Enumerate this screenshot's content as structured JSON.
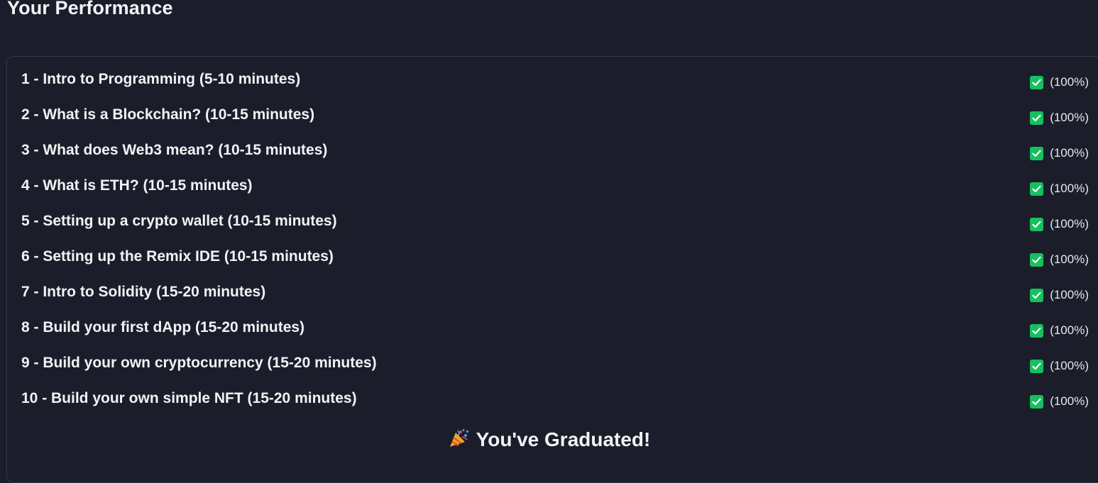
{
  "page": {
    "title": "Your Performance"
  },
  "lessons": [
    {
      "title": "1 - Intro to Programming (5-10 minutes)",
      "percent": "(100%)",
      "completed": true
    },
    {
      "title": "2 - What is a Blockchain? (10-15 minutes)",
      "percent": "(100%)",
      "completed": true
    },
    {
      "title": "3 - What does Web3 mean? (10-15 minutes)",
      "percent": "(100%)",
      "completed": true
    },
    {
      "title": "4 - What is ETH? (10-15 minutes)",
      "percent": "(100%)",
      "completed": true
    },
    {
      "title": "5 - Setting up a crypto wallet (10-15 minutes)",
      "percent": "(100%)",
      "completed": true
    },
    {
      "title": "6 - Setting up the Remix IDE (10-15 minutes)",
      "percent": "(100%)",
      "completed": true
    },
    {
      "title": "7 - Intro to Solidity (15-20 minutes)",
      "percent": "(100%)",
      "completed": true
    },
    {
      "title": "8 - Build your first dApp (15-20 minutes)",
      "percent": "(100%)",
      "completed": true
    },
    {
      "title": "9 - Build your own cryptocurrency (15-20 minutes)",
      "percent": "(100%)",
      "completed": true
    },
    {
      "title": "10 - Build your own simple NFT (15-20 minutes)",
      "percent": "(100%)",
      "completed": true
    }
  ],
  "graduation": {
    "icon": "party-popper-icon",
    "message": "You've Graduated!"
  },
  "colors": {
    "background": "#1b1e2a",
    "check": "#16c05f",
    "border": "#343846",
    "text": "#f2f3f5"
  }
}
